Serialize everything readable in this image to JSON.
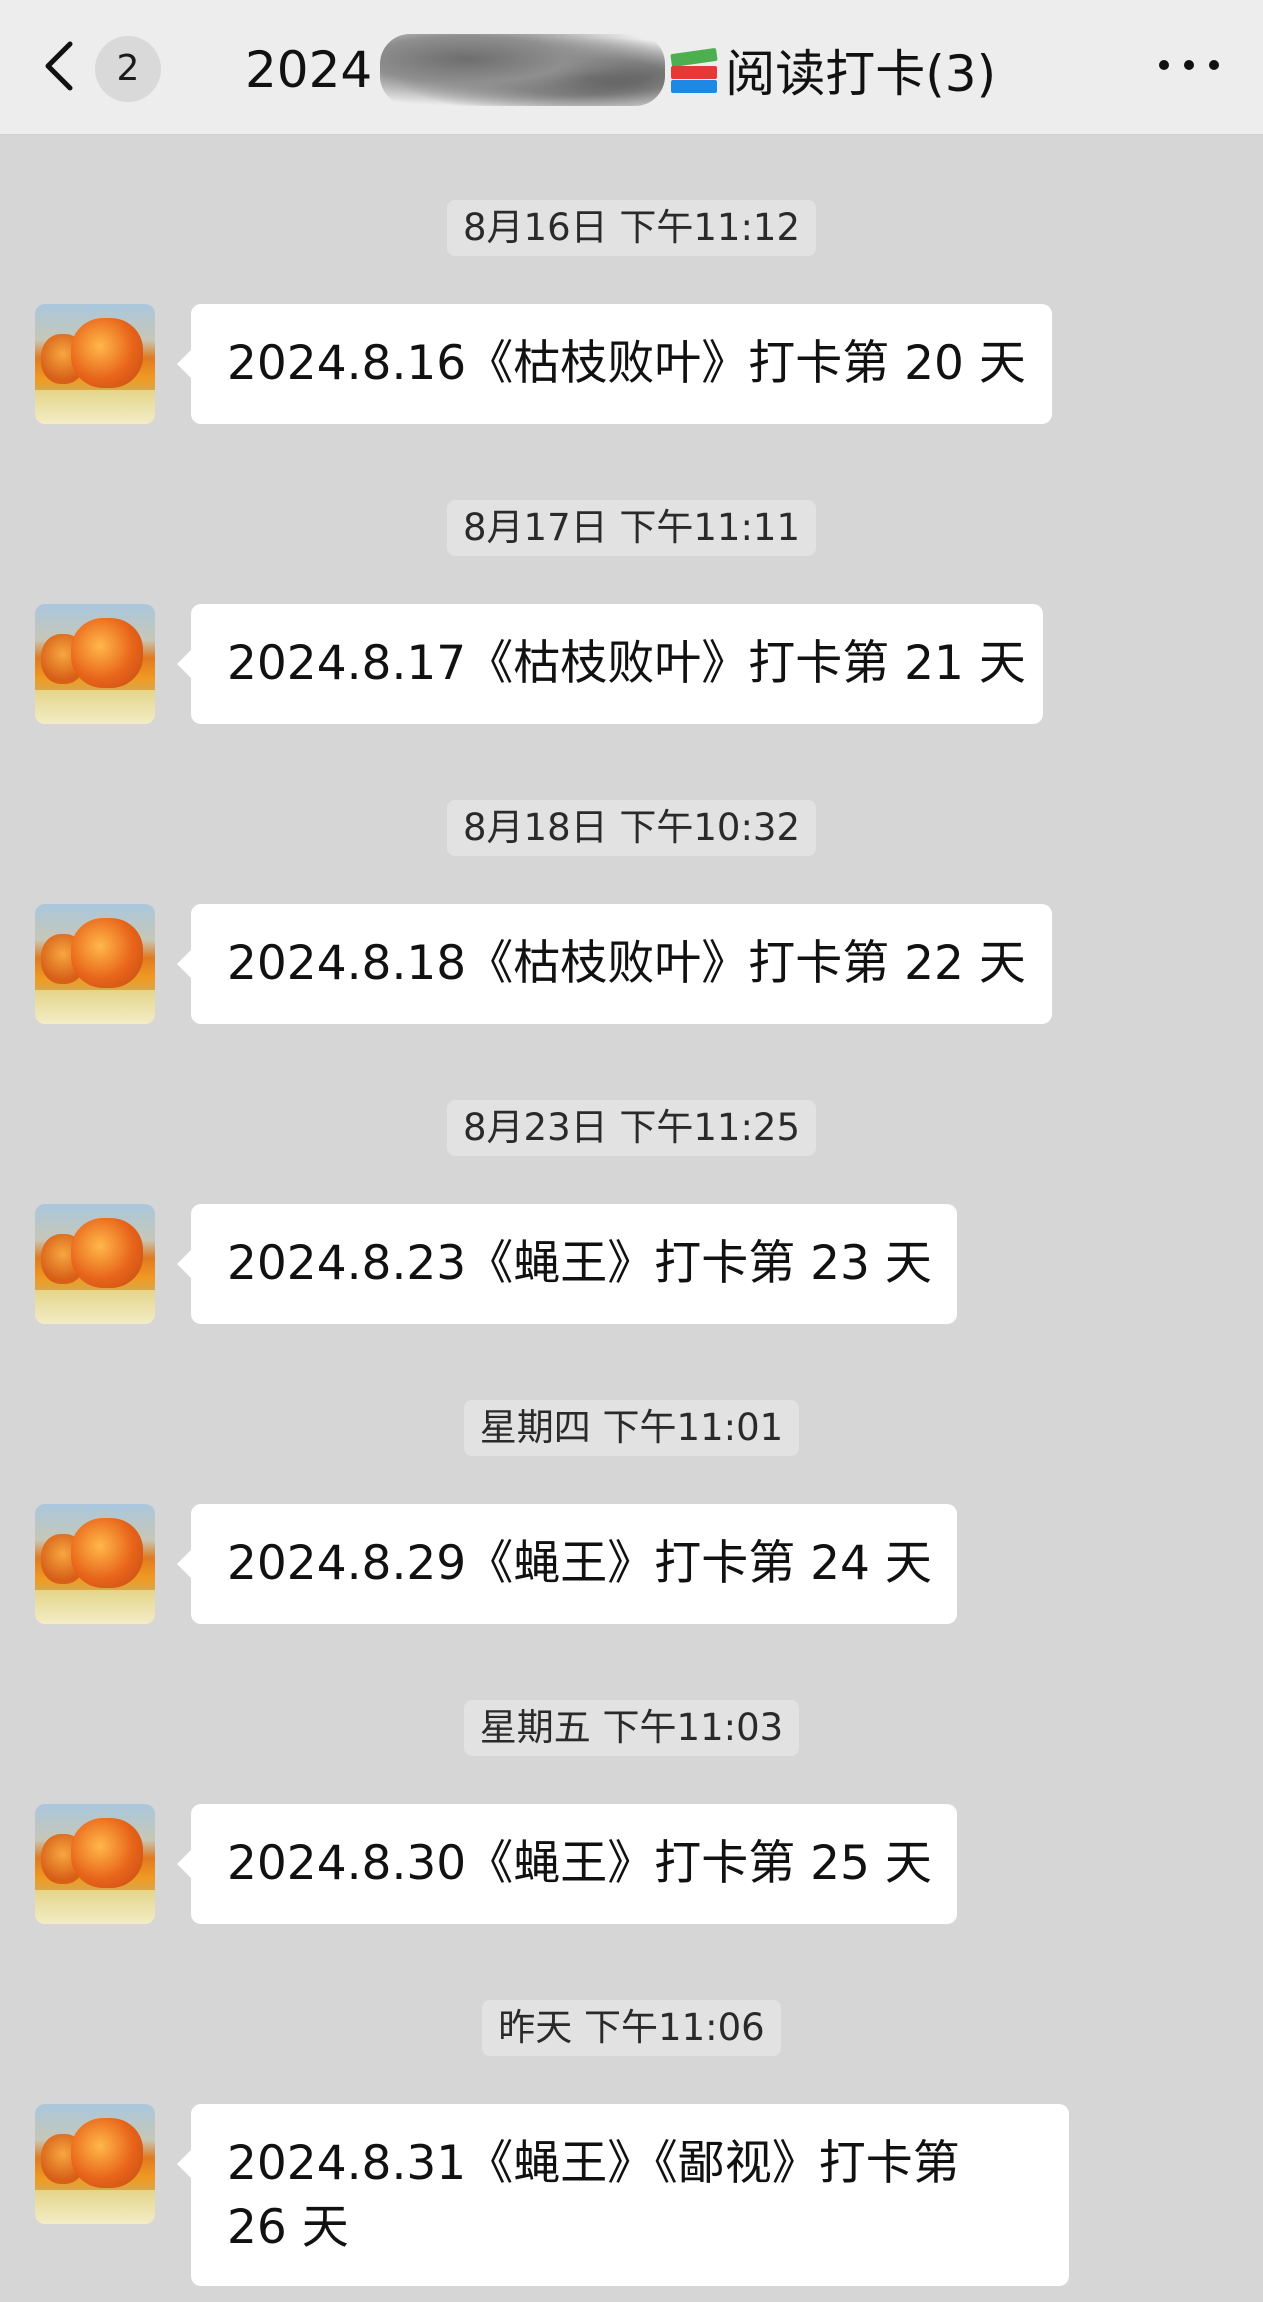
{
  "header": {
    "unread_count": "2",
    "title_prefix": "2024",
    "title_suffix": "阅读打卡(3)",
    "books_icon": "books-icon",
    "more_icon": "more-icon",
    "back_icon": "chevron-left-icon"
  },
  "messages": [
    {
      "timestamp": "8月16日 下午11:12",
      "text": "2024.8.16《枯枝败叶》打卡第 20 天"
    },
    {
      "timestamp": "8月17日 下午11:11",
      "text": "2024.8.17《枯枝败叶》打卡第 21 天"
    },
    {
      "timestamp": "8月18日 下午10:32",
      "text": "2024.8.18《枯枝败叶》打卡第 22 天"
    },
    {
      "timestamp": "8月23日 下午11:25",
      "text": "2024.8.23《蝇王》打卡第 23 天"
    },
    {
      "timestamp": "星期四 下午11:01",
      "text": "2024.8.29《蝇王》打卡第 24 天"
    },
    {
      "timestamp": "星期五 下午11:03",
      "text": "2024.8.30《蝇王》打卡第 25 天"
    },
    {
      "timestamp": "昨天 下午11:06",
      "text": "2024.8.31《蝇王》《鄙视》打卡第 26 天"
    }
  ]
}
